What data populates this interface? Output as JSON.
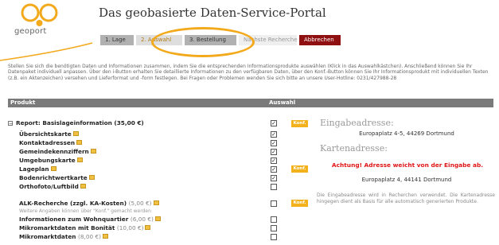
{
  "header": {
    "logo_text": "geoport",
    "title": "Das geobasierte Daten-Service-Portal",
    "steps": [
      "1. Lage",
      "2. Auswahl",
      "3. Bestellung",
      "Nächste Recherche"
    ],
    "cancel_label": "Abbrechen"
  },
  "intro": "Stellen Sie sich die benötigten Daten und Informationen zusammen, indem Sie die entsprechenden Informationsprodukte auswählen (Klick in das Auswahlkästchen). Anschließend können Sie Ihr Datenpaket individuell anpassen. Über den i-Button erhalten Sie detaillierte Informationen zu den verfügbaren Daten, über den Konf.-Button können Sie Ihr Informationsprodukt mit individuellen Texten (z.B. ein Aktenzeichen) versehen und Lieferformat und -form festlegen. Bei Fragen oder Problemen wenden Sie sich bitte an unsere User-Hotline: 0231/427988-28",
  "table": {
    "col_product": "Produkt",
    "col_select": "Auswahl"
  },
  "konf_label": "Konf.",
  "products": {
    "report": {
      "name": "Report: Basislageinformation",
      "price": "(35,00 €)",
      "checked": true
    },
    "items": [
      {
        "name": "Übersichtskarte",
        "checked": true
      },
      {
        "name": "Kontaktadressen",
        "checked": true
      },
      {
        "name": "Gemeindekennziffern",
        "checked": true
      },
      {
        "name": "Umgebungskarte",
        "checked": true
      },
      {
        "name": "Lageplan",
        "checked": true
      },
      {
        "name": "Bodenrichtwertkarte",
        "checked": true
      },
      {
        "name": "Orthofoto/Luftbild",
        "checked": false
      }
    ],
    "alk": {
      "name": "ALK-Recherche (zzgl. KA-Kosten)",
      "price": "(5,00 €)",
      "note": "Weitere Angaben können über \"Konf.\" gemacht werden",
      "checked": false
    },
    "wohnquartier": {
      "name": "Informationen zum Wohnquartier",
      "price": "(6,00 €)",
      "checked": false
    },
    "mikro_bonitaet": {
      "name": "Mikromarktdaten mit Bonität",
      "price": "(10,00 €)",
      "checked": false
    },
    "mikro": {
      "name": "Mikromarktdaten",
      "price": "(8,00 €)",
      "checked": false
    }
  },
  "panel": {
    "input_heading": "Eingabeadresse:",
    "input_address": "Europaplatz 4-5, 44269 Dortmund",
    "map_heading": "Kartenadresse:",
    "warning": "Achtung! Adresse weicht von der Eingabe ab.",
    "map_address": "Europaplatz 4, 44141 Dortmund",
    "note": "Die Eingabeadresse wird in Recherchen verwendet. Die Kartenadresse hingegen dient als Basis für alle automatisch generierten Produkte."
  },
  "colors": {
    "accent": "#f3a91c",
    "cancel": "#8e1010",
    "warning": "#e01515"
  }
}
